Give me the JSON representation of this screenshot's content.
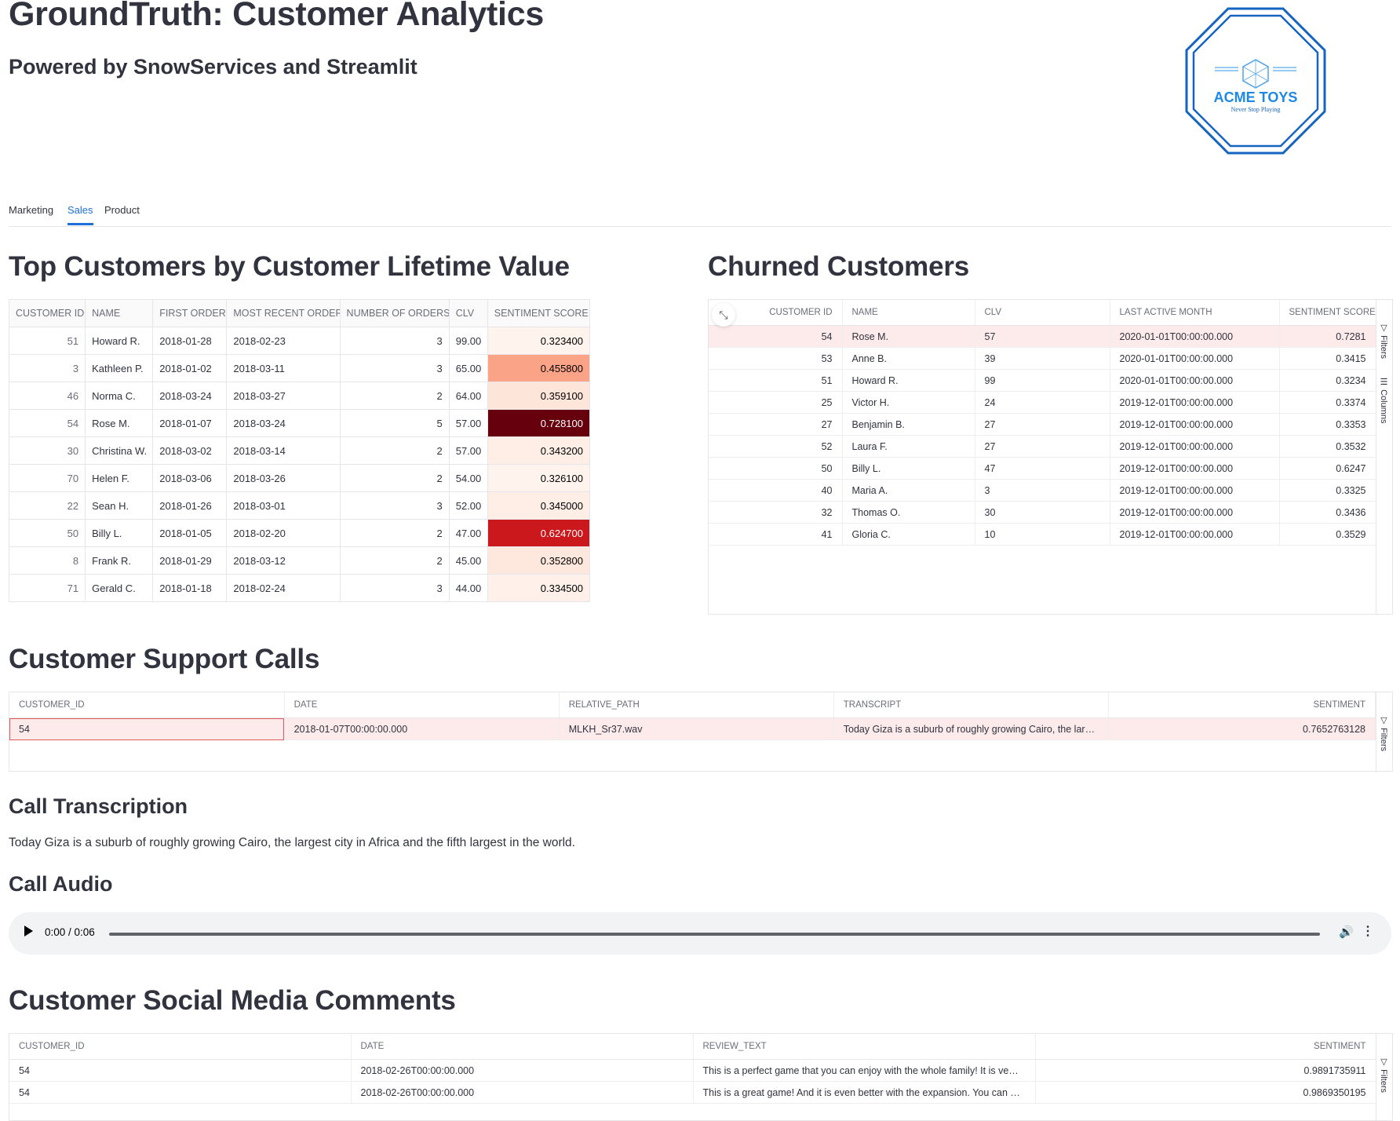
{
  "header": {
    "title": "GroundTruth: Customer Analytics",
    "subtitle": "Powered by SnowServices and Streamlit",
    "logo": {
      "name": "ACME TOYS",
      "tagline": "Never Stop Playing",
      "color": "#1565c0"
    }
  },
  "tabs": [
    {
      "label": "Marketing",
      "active": false
    },
    {
      "label": "Sales",
      "active": true
    },
    {
      "label": "Product",
      "active": false
    }
  ],
  "top_customers": {
    "title": "Top Customers by Customer Lifetime Value",
    "columns": [
      "CUSTOMER ID",
      "NAME",
      "FIRST ORDER",
      "MOST RECENT ORDER",
      "NUMBER OF ORDERS",
      "CLV",
      "SENTIMENT SCORE"
    ],
    "rows": [
      [
        "51",
        "Howard R.",
        "2018-01-28",
        "2018-02-23",
        "3",
        "99.00",
        "0.323400"
      ],
      [
        "3",
        "Kathleen P.",
        "2018-01-02",
        "2018-03-11",
        "3",
        "65.00",
        "0.455800"
      ],
      [
        "46",
        "Norma C.",
        "2018-03-24",
        "2018-03-27",
        "2",
        "64.00",
        "0.359100"
      ],
      [
        "54",
        "Rose M.",
        "2018-01-07",
        "2018-03-24",
        "5",
        "57.00",
        "0.728100"
      ],
      [
        "30",
        "Christina W.",
        "2018-03-02",
        "2018-03-14",
        "2",
        "57.00",
        "0.343200"
      ],
      [
        "70",
        "Helen F.",
        "2018-03-06",
        "2018-03-26",
        "2",
        "54.00",
        "0.326100"
      ],
      [
        "22",
        "Sean H.",
        "2018-01-26",
        "2018-03-01",
        "3",
        "52.00",
        "0.345000"
      ],
      [
        "50",
        "Billy L.",
        "2018-01-05",
        "2018-02-20",
        "2",
        "47.00",
        "0.624700"
      ],
      [
        "8",
        "Frank R.",
        "2018-01-29",
        "2018-03-12",
        "2",
        "45.00",
        "0.352800"
      ],
      [
        "71",
        "Gerald C.",
        "2018-01-18",
        "2018-02-24",
        "3",
        "44.00",
        "0.334500"
      ]
    ],
    "sentiment_bg": [
      "#fff3ee",
      "#fba387",
      "#fee5d9",
      "#67000d",
      "#feeee6",
      "#fff3ee",
      "#feeee5",
      "#cb181d",
      "#fee7dc",
      "#fff0e9"
    ],
    "sentiment_fg": [
      "#000000",
      "#000000",
      "#000000",
      "#ffffff",
      "#000000",
      "#000000",
      "#000000",
      "#ffffff",
      "#000000",
      "#000000"
    ]
  },
  "churned": {
    "title": "Churned Customers",
    "columns": [
      "CUSTOMER ID",
      "NAME",
      "CLV",
      "LAST ACTIVE MONTH",
      "SENTIMENT SCORE"
    ],
    "rows": [
      [
        "54",
        "Rose M.",
        "57",
        "2020-01-01T00:00:00.000",
        "0.7281"
      ],
      [
        "53",
        "Anne B.",
        "39",
        "2020-01-01T00:00:00.000",
        "0.3415"
      ],
      [
        "51",
        "Howard R.",
        "99",
        "2020-01-01T00:00:00.000",
        "0.3234"
      ],
      [
        "25",
        "Victor H.",
        "24",
        "2019-12-01T00:00:00.000",
        "0.3374"
      ],
      [
        "27",
        "Benjamin B.",
        "27",
        "2019-12-01T00:00:00.000",
        "0.3353"
      ],
      [
        "52",
        "Laura F.",
        "27",
        "2019-12-01T00:00:00.000",
        "0.3532"
      ],
      [
        "50",
        "Billy L.",
        "47",
        "2019-12-01T00:00:00.000",
        "0.6247"
      ],
      [
        "40",
        "Maria A.",
        "3",
        "2019-12-01T00:00:00.000",
        "0.3325"
      ],
      [
        "32",
        "Thomas O.",
        "30",
        "2019-12-01T00:00:00.000",
        "0.3436"
      ],
      [
        "41",
        "Gloria C.",
        "10",
        "2019-12-01T00:00:00.000",
        "0.3529"
      ]
    ],
    "sidebar": [
      "Filters",
      "Columns"
    ]
  },
  "support_calls": {
    "title": "Customer Support Calls",
    "columns": [
      "CUSTOMER_ID",
      "DATE",
      "RELATIVE_PATH",
      "TRANSCRIPT",
      "SENTIMENT"
    ],
    "rows": [
      [
        "54",
        "2018-01-07T00:00:00.000",
        "MLKH_Sr37.wav",
        "Today Giza is a suburb of roughly growing Cairo, the lar…",
        "0.7652763128"
      ]
    ],
    "sidebar": [
      "Filters"
    ]
  },
  "transcription": {
    "title": "Call Transcription",
    "text": "Today Giza is a suburb of roughly growing Cairo, the largest city in Africa and the fifth largest in the world."
  },
  "audio": {
    "title": "Call Audio",
    "time": "0:00 / 0:06"
  },
  "social": {
    "title": "Customer Social Media Comments",
    "columns": [
      "CUSTOMER_ID",
      "DATE",
      "REVIEW_TEXT",
      "SENTIMENT"
    ],
    "rows": [
      [
        "54",
        "2018-02-26T00:00:00.000",
        "This is a perfect game that you can enjoy with the whole family! It is ve…",
        "0.9891735911"
      ],
      [
        "54",
        "2018-02-26T00:00:00.000",
        "This is a great game! And it is even better with the expansion. You can …",
        "0.9869350195"
      ]
    ],
    "sidebar": [
      "Filters"
    ]
  }
}
